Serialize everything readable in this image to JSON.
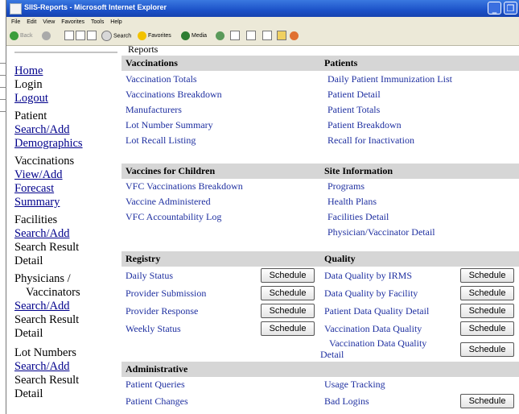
{
  "window": {
    "title": "SIIS-Reports - Microsoft Internet Explorer",
    "minimize_icon": "minimize-icon",
    "maximize_icon": "maximize-icon"
  },
  "menu": [
    "File",
    "Edit",
    "View",
    "Favorites",
    "Tools",
    "Help"
  ],
  "toolbar": {
    "back": "Back",
    "search": "Search",
    "favorites": "Favorites",
    "media": "Media"
  },
  "nav": {
    "home": "Home",
    "login": "Login",
    "logout": "Logout",
    "patient": "Patient",
    "patient_search_add": "Search/Add",
    "demographics": "Demographics",
    "vaccinations": "Vaccinations",
    "view_add": "View/Add",
    "forecast": "Forecast",
    "summary": "Summary",
    "facilities": "Facilities",
    "facilities_search_add": "Search/Add",
    "facilities_search_result": "Search Result",
    "facilities_detail": "Detail",
    "physicians": "Physicians /",
    "vaccinators": "Vaccinators",
    "physicians_search_add": "Search/Add",
    "physicians_search_result": "Search Result",
    "physicians_detail": "Detail",
    "lot_numbers": "Lot Numbers",
    "lot_search_add": "Search/Add",
    "lot_search_result": "Search Result",
    "lot_detail": "Detail"
  },
  "reports": {
    "title": "Reports",
    "vaccinations_header": "Vaccinations",
    "patients_header": "Patients",
    "vaccinations": [
      "Vaccination Totals",
      "Vaccinations Breakdown",
      "Manufacturers",
      "Lot Number Summary",
      "Lot Recall Listing"
    ],
    "patients": [
      "Daily Patient Immunization List",
      "Patient Detail",
      "Patient Totals",
      "Patient Breakdown",
      "Recall for Inactivation"
    ],
    "vfc_header": "Vaccines for Children",
    "site_header": "Site Information",
    "vfc": [
      "VFC Vaccinations Breakdown",
      "Vaccine Administered",
      "VFC Accountability Log"
    ],
    "site": [
      "Programs",
      "Health Plans",
      "Facilities Detail",
      "Physician/Vaccinator Detail"
    ],
    "registry_header": "Registry",
    "quality_header": "Quality",
    "registry": [
      "Daily Status",
      "Provider Submission",
      "Provider Response",
      "Weekly Status"
    ],
    "quality": [
      "Data Quality by IRMS",
      "Data Quality by Facility",
      "Patient Data Quality Detail",
      "Vaccination Data Quality",
      "Vaccination Data Quality",
      "Detail"
    ],
    "admin_header": "Administrative",
    "admin_left": [
      "Patient Queries",
      "Patient Changes"
    ],
    "admin_right": [
      "Usage Tracking",
      "Bad Logins"
    ],
    "schedule_label": "Schedule"
  }
}
